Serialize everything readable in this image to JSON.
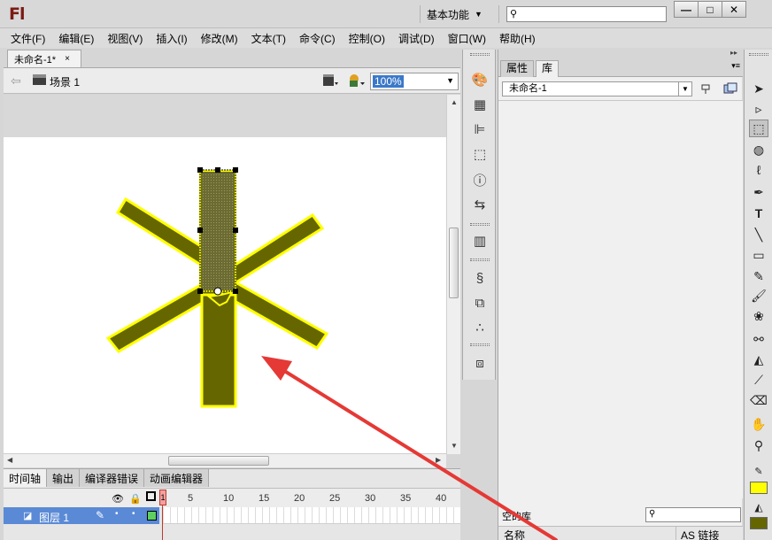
{
  "app": {
    "logo": "Fl"
  },
  "titlebar": {
    "workspace": "基本功能",
    "search_value": "",
    "buttons": [
      "minimize-icon",
      "maximize-icon",
      "close-icon"
    ]
  },
  "menus": [
    "文件(F)",
    "编辑(E)",
    "视图(V)",
    "插入(I)",
    "修改(M)",
    "文本(T)",
    "命令(C)",
    "控制(O)",
    "调试(D)",
    "窗口(W)",
    "帮助(H)"
  ],
  "document": {
    "tab_title": "未命名-1*",
    "tab_close": "×",
    "scene": "场景 1",
    "zoom": "100%"
  },
  "stage": {
    "shape_fill": "#666600",
    "shape_stroke": "#ffff00",
    "selected_arm_fill": "#6e6e2a"
  },
  "timeline": {
    "tabs": [
      "时间轴",
      "输出",
      "编译器错误",
      "动画编辑器"
    ],
    "frame_numbers": [
      "1",
      "5",
      "10",
      "15",
      "20",
      "25",
      "30",
      "35",
      "40"
    ],
    "current_frame": "1",
    "layer_name": "图层 1"
  },
  "library": {
    "tabs": [
      "属性",
      "库"
    ],
    "active_tab": "库",
    "selected_doc": "未命名-1",
    "item_count": "空的库",
    "search_value": "",
    "columns": {
      "name": "名称",
      "linkage": "AS 链接"
    }
  },
  "colors": {
    "stroke": "#ffff00",
    "fill": "#666600",
    "annotation_arrow": "#e53935",
    "layer_highlight": "#5a8ad6"
  }
}
